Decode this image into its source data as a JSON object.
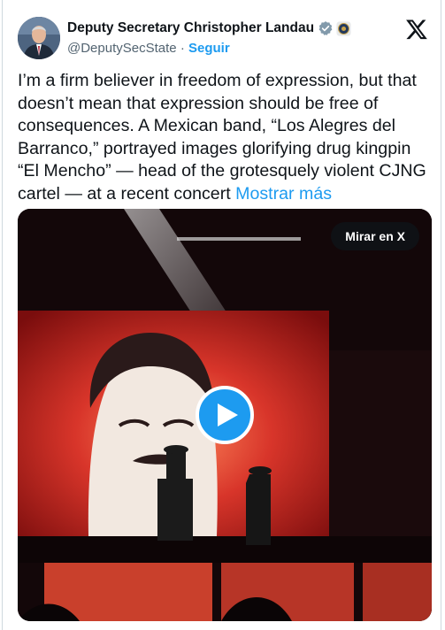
{
  "header": {
    "display_name": "Deputy Secretary Christopher Landau",
    "handle": "@DeputySecState",
    "separator": "·",
    "follow_label": "Seguir"
  },
  "tweet": {
    "text": "I’m a firm believer in freedom of expression, but that doesn’t mean that expression should be free of consequences. A Mexican band, “Los Alegres del Barranco,” portrayed images glorifying drug kingpin “El Mencho” — head of the grotesquely violent CJNG cartel — at a recent concert",
    "show_more": "Mostrar más"
  },
  "media": {
    "watch_label": "Mirar en X"
  },
  "icons": {
    "verified": "verified-badge-icon",
    "seal": "government-seal-icon",
    "brand": "x-logo-icon",
    "play": "play-icon"
  },
  "colors": {
    "accent": "#1d9bf0",
    "text": "#0f1419",
    "muted": "#536471"
  }
}
